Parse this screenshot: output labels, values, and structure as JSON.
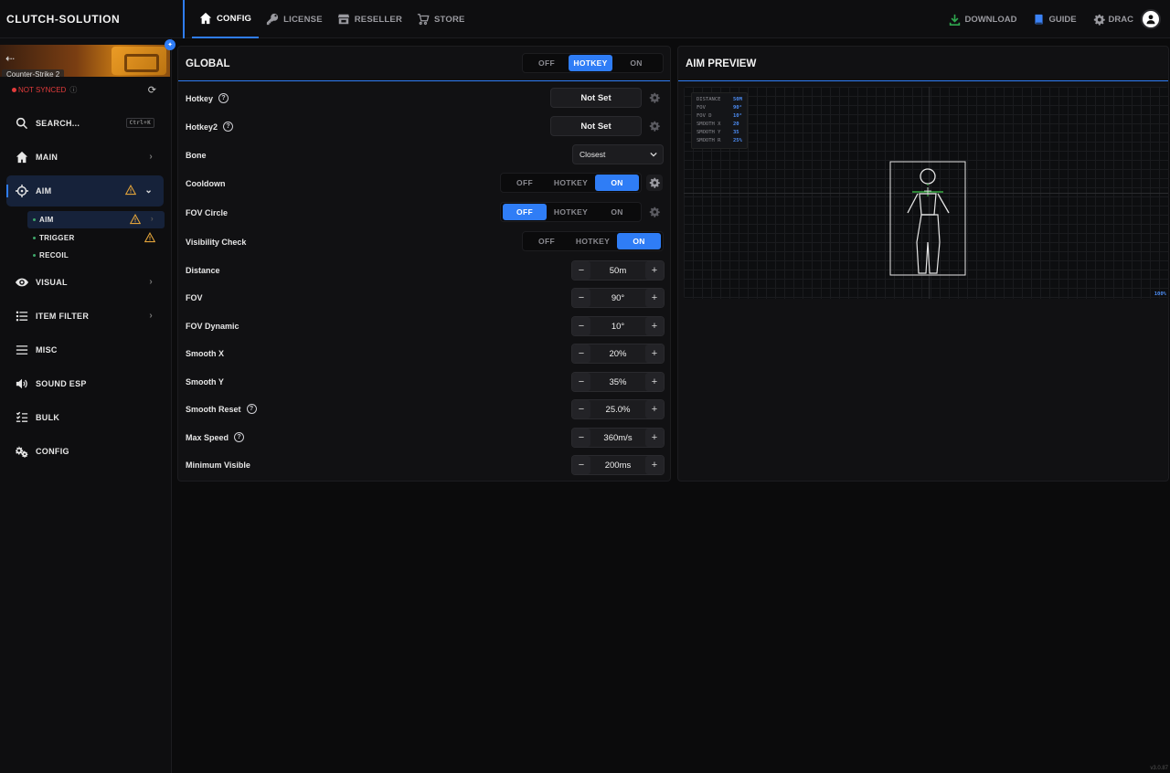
{
  "brand": "CLUTCH-SOLUTION",
  "topnav": [
    {
      "label": "CONFIG",
      "icon": "home-icon",
      "active": true
    },
    {
      "label": "LICENSE",
      "icon": "key-icon"
    },
    {
      "label": "RESELLER",
      "icon": "store-icon"
    },
    {
      "label": "STORE",
      "icon": "cart-icon"
    }
  ],
  "topright": {
    "download": "DOWNLOAD",
    "guide": "GUIDE",
    "user": "DRAC"
  },
  "game": {
    "name": "Counter-Strike 2",
    "sync_status": "NOT SYNCED"
  },
  "sidebar": {
    "search": "SEARCH...",
    "shortcut": "Ctrl+K",
    "items": {
      "main": "MAIN",
      "aim": "AIM",
      "visual": "VISUAL",
      "item_filter": "ITEM FILTER",
      "misc": "MISC",
      "sound_esp": "SOUND ESP",
      "bulk": "BULK",
      "config": "CONFIG"
    },
    "aim_sub": {
      "aim": "AIM",
      "trigger": "TRIGGER",
      "recoil": "RECOIL"
    }
  },
  "global": {
    "title": "GLOBAL",
    "mode": {
      "off": "OFF",
      "hotkey": "HOTKEY",
      "on": "ON",
      "selected": "HOTKEY"
    },
    "rows": {
      "hotkey": {
        "label": "Hotkey",
        "value": "Not Set"
      },
      "hotkey2": {
        "label": "Hotkey2",
        "value": "Not Set"
      },
      "bone": {
        "label": "Bone",
        "value": "Closest"
      },
      "cooldown": {
        "label": "Cooldown",
        "selected": "ON"
      },
      "fov_circle": {
        "label": "FOV Circle",
        "selected": "OFF"
      },
      "visibility_check": {
        "label": "Visibility Check",
        "selected": "ON"
      },
      "distance": {
        "label": "Distance",
        "value": "50m"
      },
      "fov": {
        "label": "FOV",
        "value": "90°"
      },
      "fov_dynamic": {
        "label": "FOV Dynamic",
        "value": "10°"
      },
      "smooth_x": {
        "label": "Smooth X",
        "value": "20%"
      },
      "smooth_y": {
        "label": "Smooth Y",
        "value": "35%"
      },
      "smooth_reset": {
        "label": "Smooth Reset",
        "value": "25.0%"
      },
      "max_speed": {
        "label": "Max Speed",
        "value": "360m/s"
      },
      "minimum_visible": {
        "label": "Minimum Visible",
        "value": "200ms"
      }
    },
    "seg": {
      "off": "OFF",
      "hotkey": "HOTKEY",
      "on": "ON"
    }
  },
  "preview": {
    "title": "AIM PREVIEW",
    "stats": [
      {
        "k": "DISTANCE",
        "v": "50M"
      },
      {
        "k": "FOV",
        "v": "90°"
      },
      {
        "k": "FOV D",
        "v": "10°"
      },
      {
        "k": "SMOOTH X",
        "v": "20"
      },
      {
        "k": "SMOOTH Y",
        "v": "35"
      },
      {
        "k": "SMOOTH R",
        "v": "25%"
      }
    ],
    "zoom": "100%"
  },
  "version": "v3.0.87",
  "colors": {
    "accent": "#2f7df6",
    "warning": "#e0a23a",
    "danger": "#e23b3b"
  }
}
